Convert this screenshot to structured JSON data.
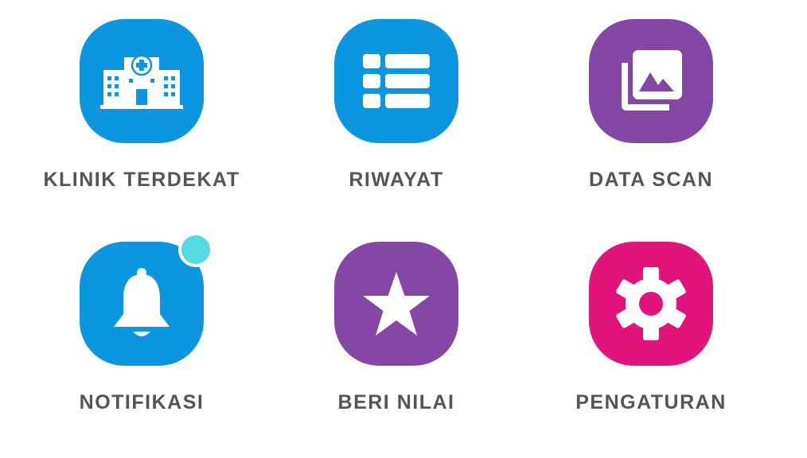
{
  "colors": {
    "blue": "#0a96e0",
    "purple": "#8447a6",
    "pink": "#e0147a",
    "badge": "#55d9e2",
    "label": "#555555"
  },
  "menu": [
    {
      "label": "KLINIK TERDEKAT",
      "icon": "hospital-icon",
      "color": "#0a96e0"
    },
    {
      "label": "RIWAYAT",
      "icon": "list-icon",
      "color": "#0a96e0"
    },
    {
      "label": "DATA SCAN",
      "icon": "photo-gallery-icon",
      "color": "#8447a6"
    },
    {
      "label": "NOTIFIKASI",
      "icon": "bell-icon",
      "color": "#0a96e0",
      "has_badge": true
    },
    {
      "label": "BERI NILAI",
      "icon": "star-icon",
      "color": "#8447a6"
    },
    {
      "label": "PENGATURAN",
      "icon": "gear-icon",
      "color": "#e0147a"
    }
  ]
}
